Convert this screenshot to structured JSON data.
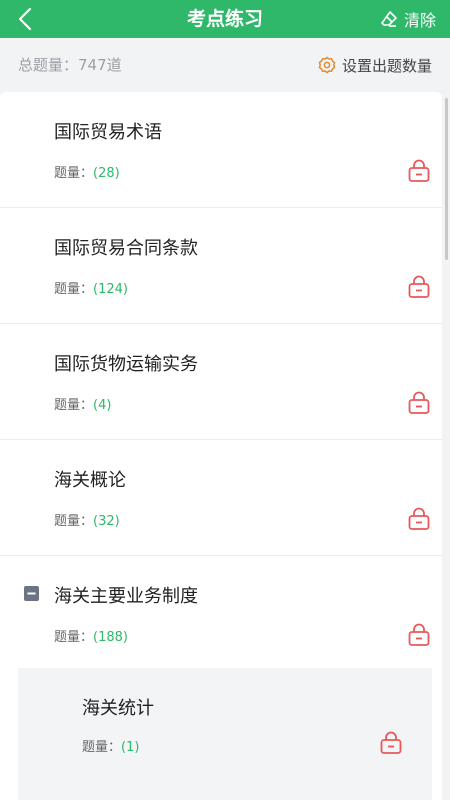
{
  "header": {
    "title": "考点练习",
    "clear_label": "清除"
  },
  "summary": {
    "total_text": "总题量：747道",
    "settings_label": "设置出题数量"
  },
  "colors": {
    "brand": "#2fb86a",
    "lock": "#e8585a"
  },
  "items": [
    {
      "name": "国际贸易术语",
      "count_label": "题量：",
      "count": "(28)"
    },
    {
      "name": "国际贸易合同条款",
      "count_label": "题量：",
      "count": "(124)"
    },
    {
      "name": "国际货物运输实务",
      "count_label": "题量：",
      "count": "(4)"
    },
    {
      "name": "海关概论",
      "count_label": "题量：",
      "count": "(32)"
    },
    {
      "name": "海关主要业务制度",
      "count_label": "题量：",
      "count": "(188)"
    }
  ],
  "sub_items": [
    {
      "name": "海关统计",
      "count_label": "题量：",
      "count": "(1)"
    }
  ],
  "icons": {
    "back": "chevron-left-icon",
    "clear": "eraser-icon",
    "settings": "gear-icon",
    "lock": "lock-icon",
    "collapse": "minus-square-icon"
  }
}
